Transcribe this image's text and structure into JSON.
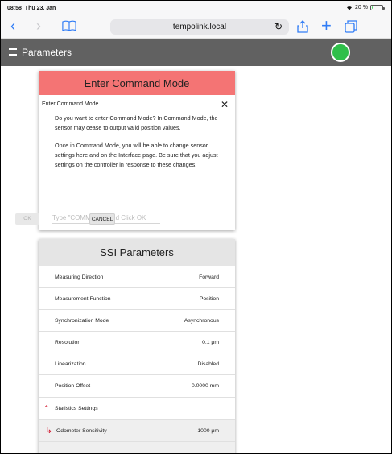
{
  "status_bar": {
    "time": "08:58",
    "date": "Thu 23. Jan",
    "battery": "20 %",
    "battery_level": 0.2
  },
  "browser": {
    "url": "tempolink.local"
  },
  "app": {
    "title": "Parameters",
    "status_color": "#2fbf4a"
  },
  "command_dialog": {
    "title": "Enter Command Mode",
    "subtitle": "Enter Command Mode",
    "paragraph1": "Do you want to enter Command Mode? In Command Mode, the sensor may cease to output valid position values.",
    "paragraph2": "Once in Command Mode, you will be able to change sensor settings here and on the Interface page. Be sure that you adjust settings on the controller in response to these changes.",
    "input_placeholder": "Type \"COMMAND\" and Click OK",
    "input_value": "",
    "ok_label": "OK",
    "cancel_label": "CANCEL"
  },
  "ssi": {
    "title": "SSI Parameters",
    "rows": [
      {
        "label": "Measuring Direction",
        "value": "Forward"
      },
      {
        "label": "Measurement Function",
        "value": "Position"
      },
      {
        "label": "Synchronization Mode",
        "value": "Asynchronous"
      },
      {
        "label": "Resolution",
        "value": "0.1 μm"
      },
      {
        "label": "Linearization",
        "value": "Disabled"
      },
      {
        "label": "Position Offset",
        "value": "0.0000 mm"
      }
    ],
    "statistics_label": "Statistics Settings",
    "odometer_label": "Odometer Sensitivity",
    "odometer_value": "1000 μm"
  },
  "colors": {
    "accent": "#2f7cf6",
    "dialog_header": "#f47474",
    "app_header": "#616161",
    "caret": "#d0021b"
  }
}
